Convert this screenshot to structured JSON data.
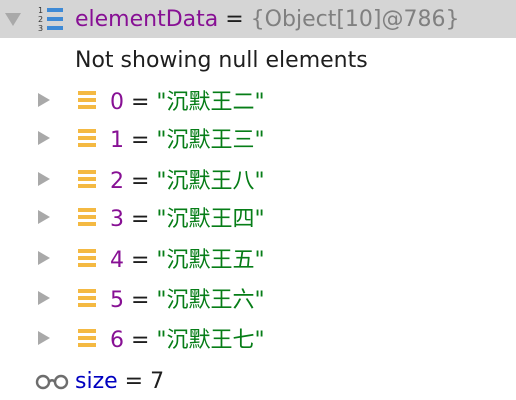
{
  "root": {
    "name": "elementData",
    "equals": " = ",
    "value": "{Object[10]@786}"
  },
  "note": "Not showing null elements",
  "items": [
    {
      "index": "0",
      "equals": " = ",
      "value": "\"沉默王二\""
    },
    {
      "index": "1",
      "equals": " = ",
      "value": "\"沉默王三\""
    },
    {
      "index": "2",
      "equals": " = ",
      "value": "\"沉默王八\""
    },
    {
      "index": "3",
      "equals": " = ",
      "value": "\"沉默王四\""
    },
    {
      "index": "4",
      "equals": " = ",
      "value": "\"沉默王五\""
    },
    {
      "index": "5",
      "equals": " = ",
      "value": "\"沉默王六\""
    },
    {
      "index": "6",
      "equals": " = ",
      "value": "\"沉默王七\""
    }
  ],
  "size": {
    "name": "size",
    "equals": " = ",
    "value": "7"
  },
  "colors": {
    "selection": "#d5d5d5",
    "variable": "#871094",
    "string": "#067d17",
    "field": "#0000c0",
    "muted": "#808080",
    "list_icon_blue": "#3e8ad6",
    "field_icon_orange": "#f4b942"
  },
  "icons": {
    "root": "numbered-list-icon",
    "item": "array-element-icon",
    "size": "watch-glasses-icon",
    "expanded": "expanded-arrow-icon",
    "collapsed": "collapsed-arrow-icon"
  }
}
